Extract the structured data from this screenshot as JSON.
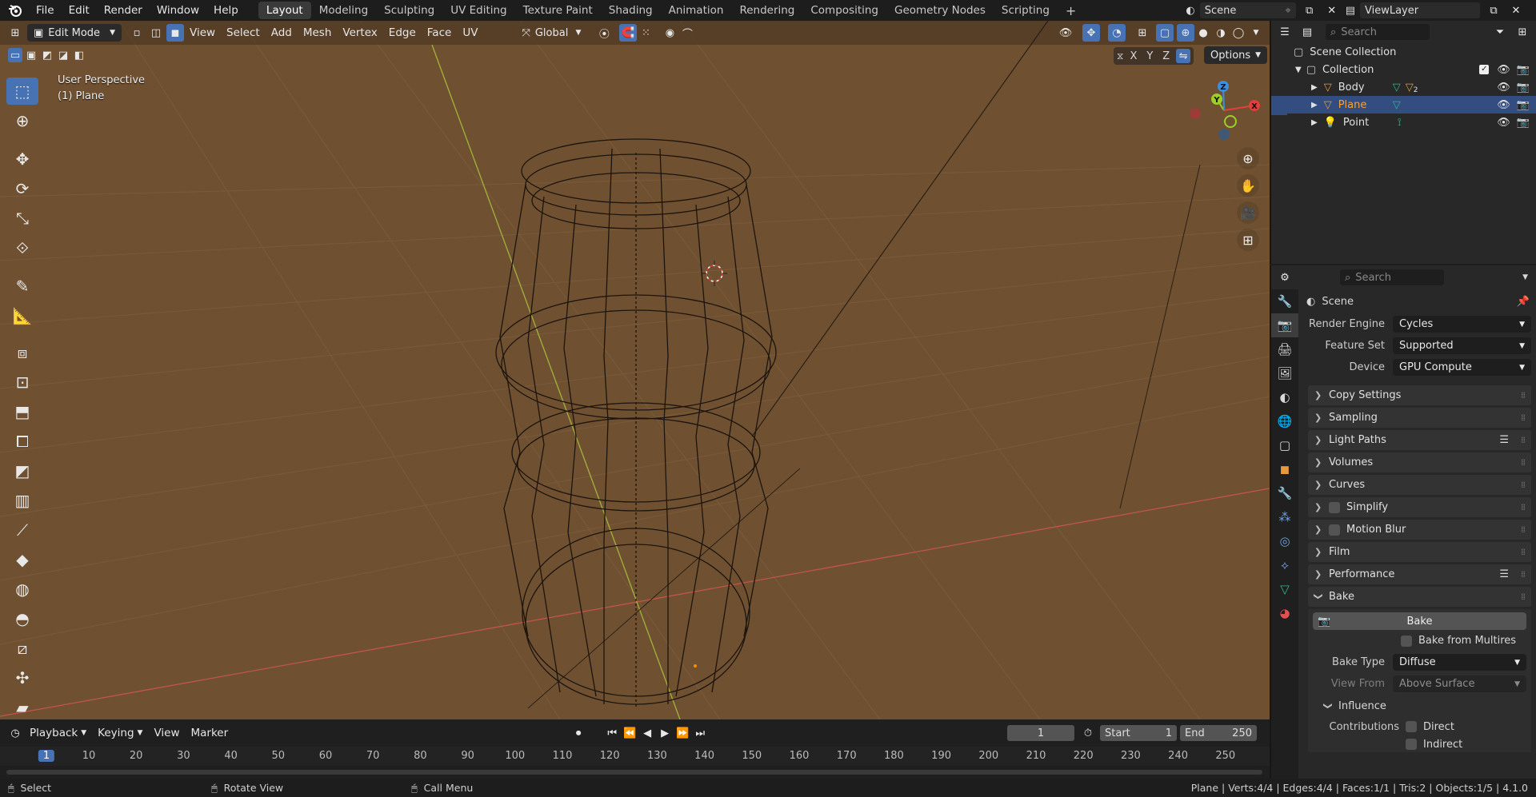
{
  "menu": [
    "File",
    "Edit",
    "Render",
    "Window",
    "Help"
  ],
  "workspaces": [
    "Layout",
    "Modeling",
    "Sculpting",
    "UV Editing",
    "Texture Paint",
    "Shading",
    "Animation",
    "Rendering",
    "Compositing",
    "Geometry Nodes",
    "Scripting"
  ],
  "active_workspace": "Layout",
  "scene_name": "Scene",
  "view_layer": "ViewLayer",
  "viewport": {
    "mode": "Edit Mode",
    "header_menus": [
      "View",
      "Select",
      "Add",
      "Mesh",
      "Vertex",
      "Edge",
      "Face",
      "UV"
    ],
    "orientation": "Global",
    "overlay_label_line1": "User Perspective",
    "overlay_label_line2": "(1) Plane",
    "options_label": "Options",
    "axes": {
      "x": "X",
      "y": "Y",
      "z": "Z"
    }
  },
  "outliner": {
    "search_placeholder": "Search",
    "root": "Scene Collection",
    "collection": "Collection",
    "items": [
      {
        "name": "Body",
        "badge": "2",
        "selected": false
      },
      {
        "name": "Plane",
        "badge": "",
        "selected": true
      },
      {
        "name": "Point",
        "badge": "",
        "selected": false
      }
    ]
  },
  "properties": {
    "search_placeholder": "Search",
    "context": "Scene",
    "render_engine_label": "Render Engine",
    "render_engine": "Cycles",
    "feature_set_label": "Feature Set",
    "feature_set": "Supported",
    "device_label": "Device",
    "device": "GPU Compute",
    "panels": [
      "Copy Settings",
      "Sampling",
      "Light Paths",
      "Volumes",
      "Curves",
      "Simplify",
      "Motion Blur",
      "Film",
      "Performance"
    ],
    "bake_panel": "Bake",
    "bake_button": "Bake",
    "bake_from_multires": "Bake from Multires",
    "bake_type_label": "Bake Type",
    "bake_type": "Diffuse",
    "view_from_label": "View From",
    "view_from": "Above Surface",
    "influence": "Influence",
    "contributions_label": "Contributions",
    "direct": "Direct",
    "indirect": "Indirect"
  },
  "timeline": {
    "menus": [
      "Playback",
      "Keying",
      "View",
      "Marker"
    ],
    "current_frame": "1",
    "start_label": "Start",
    "start": "1",
    "end_label": "End",
    "end": "250",
    "ticks": [
      "1",
      "10",
      "20",
      "30",
      "40",
      "50",
      "60",
      "70",
      "80",
      "90",
      "100",
      "110",
      "120",
      "130",
      "140",
      "150",
      "160",
      "170",
      "180",
      "190",
      "200",
      "210",
      "220",
      "230",
      "240",
      "250"
    ]
  },
  "statusbar": {
    "select": "Select",
    "rotate": "Rotate View",
    "call_menu": "Call Menu",
    "stats": "Plane | Verts:4/4 | Edges:4/4 | Faces:1/1 | Tris:2 | Objects:1/5 | 4.1.0"
  },
  "colors": {
    "viewport_bg": "#6f5132",
    "accent": "#4772b3",
    "x_axis": "#e0413c",
    "y_axis": "#9ccf29",
    "z_axis": "#3b8ee0"
  }
}
